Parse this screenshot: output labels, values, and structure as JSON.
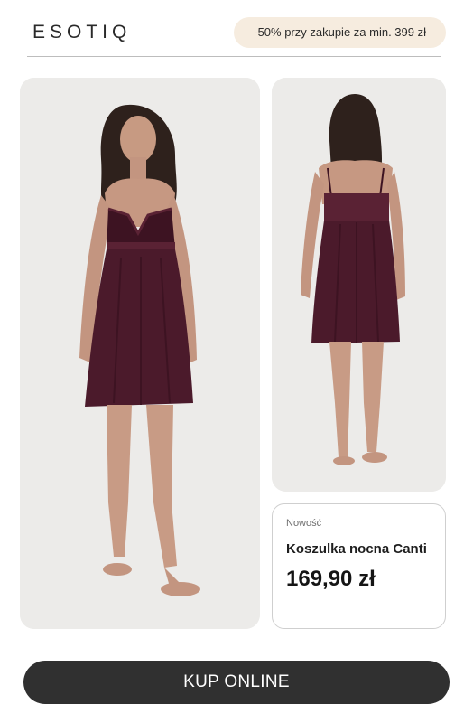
{
  "header": {
    "logo_text": "ESOTIQ",
    "promo_text": "-50% przy zakupie za min. 399 zł"
  },
  "product": {
    "badge": "Nowość",
    "name": "Koszulka nocna Canti",
    "price": "169,90 zł"
  },
  "cta": {
    "label": "KUP ONLINE"
  },
  "colors": {
    "dress": "#4b1a2b",
    "promo_background": "#f6ecdf",
    "button_background": "#303030",
    "photo_background": "#ecebe9"
  },
  "icons": {
    "photo_front": "model-front-photo",
    "photo_back": "model-back-photo"
  }
}
